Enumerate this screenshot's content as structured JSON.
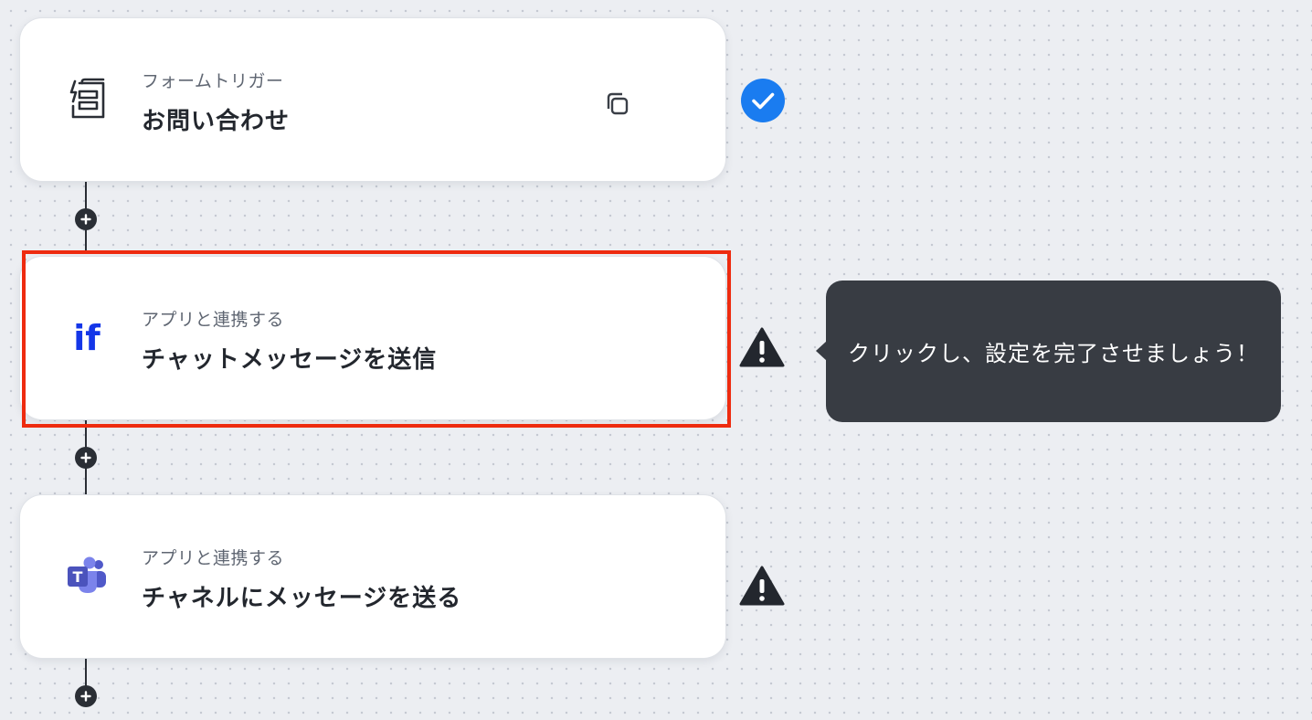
{
  "steps": [
    {
      "subtitle": "フォームトリガー",
      "title": "お問い合わせ",
      "icon": "form-trigger-icon",
      "status": "complete"
    },
    {
      "subtitle": "アプリと連携する",
      "title": "チャットメッセージを送信",
      "icon": "if-app-icon",
      "status": "warning"
    },
    {
      "subtitle": "アプリと連携する",
      "title": "チャネルにメッセージを送る",
      "icon": "microsoft-teams-icon",
      "status": "warning"
    }
  ],
  "tooltip": {
    "text": "クリックし、設定を完了させましょう！"
  },
  "colors": {
    "background": "#eceef2",
    "card": "#ffffff",
    "check": "#1a7cf0",
    "highlight": "#ee2b0f",
    "tooltip": "#383c43",
    "connector": "#2a2e35",
    "if_logo": "#1436e8",
    "teams": "#5b5fc7"
  }
}
